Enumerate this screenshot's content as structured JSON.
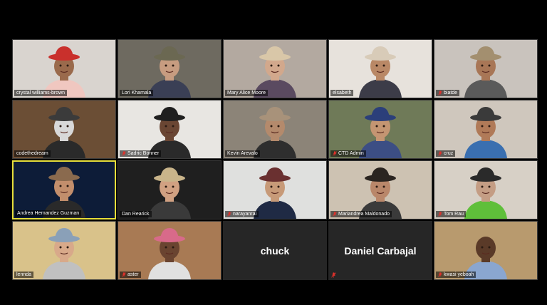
{
  "participants": [
    {
      "name": "crystal williams-brown",
      "muted": false,
      "bg": "#d9d4cf",
      "skin": "#9a6a4c",
      "hat": "#c9302c",
      "shirt": "#f0c7c0"
    },
    {
      "name": "Lori Khamala",
      "muted": false,
      "bg": "#6e6a60",
      "skin": "#c79c80",
      "hat": "#6b6852",
      "shirt": "#3a3f55"
    },
    {
      "name": "Mary Alice Moore",
      "muted": false,
      "bg": "#b3a9a0",
      "skin": "#d2a88c",
      "hat": "#d9c7a8",
      "shirt": "#5a4a60"
    },
    {
      "name": "elsabeth",
      "muted": false,
      "bg": "#e7e2dc",
      "skin": "#b98866",
      "hat": "#d8cbb8",
      "shirt": "#3c3c48"
    },
    {
      "name": "biatde",
      "muted": true,
      "bg": "#c9c3bd",
      "skin": "#a87656",
      "hat": "#a38f6f",
      "shirt": "#5a5a5a"
    },
    {
      "name": "codethedream",
      "muted": false,
      "bg": "#6b4e35",
      "skin": "#d8d8d8",
      "hat": "#3b3b3b",
      "shirt": "#2a2a2a"
    },
    {
      "name": "Sadric Bonner",
      "muted": true,
      "bg": "#e8e6e2",
      "skin": "#6a4633",
      "hat": "#1f1f1f",
      "shirt": "#2a2a2a"
    },
    {
      "name": "Kevin Arevalo",
      "muted": false,
      "bg": "#8c8478",
      "skin": "#b48a6c",
      "hat": "#a8927a",
      "shirt": "#2e2e2e"
    },
    {
      "name": "CTD Admin",
      "muted": true,
      "bg": "#6f7a58",
      "skin": "#c49572",
      "hat": "#2b3f7a",
      "shirt": "#3c4e84"
    },
    {
      "name": "cruz",
      "muted": true,
      "bg": "#cfc7bd",
      "skin": "#b07a58",
      "hat": "#3a3a3a",
      "shirt": "#3a6fb0"
    },
    {
      "name": "Andrea Hernandez Guzman",
      "muted": false,
      "bg": "#0d1c38",
      "skin": "#c28e6c",
      "hat": "#8a6a4e",
      "shirt": "#2a2a2a"
    },
    {
      "name": "Dan Rearick",
      "muted": false,
      "bg": "#1f1f1f",
      "skin": "#d1a182",
      "hat": "#c9b48a",
      "shirt": "#3a3a3a"
    },
    {
      "name": "narayanrai",
      "muted": true,
      "bg": "#dfe0de",
      "skin": "#c79a78",
      "hat": "#6a3030",
      "shirt": "#1f2a44"
    },
    {
      "name": "Mariandrea Maldonado",
      "muted": true,
      "bg": "#cdc2b2",
      "skin": "#b9876a",
      "hat": "#2a2420",
      "shirt": "#3a3a3a"
    },
    {
      "name": "Tom Rau",
      "muted": true,
      "bg": "#d7d0c6",
      "skin": "#c49d84",
      "hat": "#2a2a2a",
      "shirt": "#5fbf3a"
    },
    {
      "name": "lennda",
      "muted": false,
      "bg": "#d9c28a",
      "skin": "#d8a98a",
      "hat": "#8aa0b8",
      "shirt": "#c0c0c0"
    },
    {
      "name": "aster",
      "muted": true,
      "bg": "#a87a54",
      "skin": "#6a4430",
      "hat": "#d86a8a",
      "shirt": "#e0e0e0"
    }
  ],
  "video_off": [
    {
      "name": "chuck",
      "muted": false
    },
    {
      "name": "Daniel Carbajal",
      "muted": true
    }
  ],
  "last": {
    "name": "kwasi yeboah",
    "muted": true,
    "bg": "#b89a6e",
    "skin": "#5a3a28",
    "shirt": "#8aa6d0"
  },
  "active_speaker": "Andrea Hernandez Guzman",
  "colors": {
    "mute": "#e0312b",
    "active": "#e6de3a"
  }
}
